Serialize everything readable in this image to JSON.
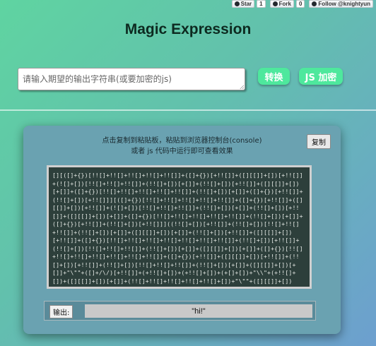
{
  "github": {
    "star_label": "Star",
    "star_count": "1",
    "fork_label": "Fork",
    "fork_count": "0",
    "follow_label": "Follow @knightyun"
  },
  "header": {
    "title": "Magic Expression"
  },
  "input": {
    "placeholder": "请输入期望的输出字符串(或要加密的js)",
    "value": ""
  },
  "buttons": {
    "convert": "转换",
    "js_encrypt": "JS 加密"
  },
  "result_panel": {
    "hint_line1": "点击复制到粘贴板，粘贴到浏览器控制台(console)",
    "hint_line2": "或者 js 代码中运行即可查看效果",
    "copy_button": "复制",
    "code": "[][([]+{})[!![]+!![]+!![]+!![]+!![]]+([]+{})[+!![]]+([][[]]+[])[+!![]]+(![]+[])[!![]+!![]+!![]]+(!![]+[])[+[]]+(!![]+[])[+!![]]+([][[]]+[])[+[]]+([]+{})[!![]+!![]+!![]+!![]+!![]]+(!![]+[])[+[]]+([]+{})[+!![]]+(!![]+[])[+!![]]][([]+{})[!![]+!![]+!![]+!![]+!![]]+([]+{})[+!![]]+([][[]]+[])[+!![]]+(![]+[])[!![]+!![]+!![]]+(!![]+[])[+[]]+(!![]+[])[+!![]]+([][[]]+[])[+[]]+([]+{})[!![]+!![]+!![]+!![]+!![]]+(!![]+[])[+[]]+([]+{})[+!![]]+(!![]+[])[+!![]]]((!![]+[])[+!![]]+(!![]+[])[!![]+!![]+!![]]+(!![]+[])[+[]]+([][[]]+[])[+[]]+(!![]+[])[+!![]]+([][[]]+[])[+!![]]+([]+{})[!![]+!![]+!![]+!![]+!![]+!![]+!![]]+(!![]+[])[+!![]]+(!![]+[])[!![]+!![]+!![]]+(!![]+[])[+[]]+([][[]]+[])[+[]]+([]+{})[!![]+!![]+!![]+!![]+!![]+!![]+!![]]+([]+{})[+!![]]+([][[]]+[])[+!![]]+(!![]+[])[+!![]]+(!![]+[])[!![]+!![]+!![]]+(!![]+[])[+[]]+([][[]]+[])[+[]]+\"\\\"\"+([]+/\\/)[+!![]]+(+!![]+[])+(+!![]+[])+(+[]+[])+\"\\\\\"+(+!![]+[])+([][[]]+[])[+[]]+(!![]+!![]+!![]+!![]+!![]+[])+\"\\\"\"+([][[]]+[])[+!![]]+(![]+[])[+!![]]+([]+{})[!![]+!![]+!![]+!![]+!![]]+(!![]+[])[!![]+!![]+!![]]+(!![]+[])[+[]]+(!![]+[])[+!![]]+([]+/\\/\\/)[+!![]]+(!![]+[])[+[]]+([]+{})[+!![]]+([][[]]+[])[+!![]]+(!![]+[])[+!![]]+(!![]+[])[!![]+!![]+!![]]+([]+{})[!![]+!![]+!![]+!![]+!![]]+(!![]+[])[+[]]+([]+{})[+!![]]+(!![]+[])[+!![]]+([][[]]+[])[+!![]]+(!![]+[])[+[]]+(!![]+[])[+!![]]+(!![]+[])[!![]+!![]+!![]]+\"\\\"\")()",
    "output_label": "输出:",
    "output_value": "\"hi!\""
  }
}
